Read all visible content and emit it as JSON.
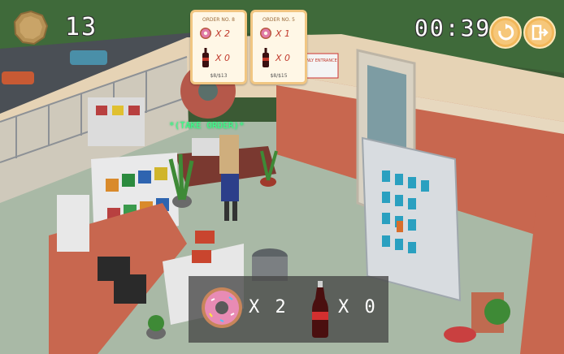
{
  "hud": {
    "coins": "13",
    "timer": "00:39",
    "icons": {
      "coin": "coin-icon",
      "restart": "restart-icon",
      "exit": "exit-icon"
    }
  },
  "orders": [
    {
      "title": "ORDER NO. 8",
      "donut_qty": "X 2",
      "cola_qty": "X 0",
      "footer": "$8/$13"
    },
    {
      "title": "ORDER NO. 5",
      "donut_qty": "X 1",
      "cola_qty": "X 0",
      "footer": "$8/$15"
    }
  ],
  "world": {
    "sign_text": "ONLY ENTRANCE",
    "customer_label": "*(TAKE ORDER)*"
  },
  "inventory": {
    "donut_qty": "X 2",
    "cola_qty": "X 0"
  },
  "colors": {
    "hud_button": "#f6c77a",
    "card_border": "#f1c682",
    "talk_label": "#3dff8a"
  }
}
